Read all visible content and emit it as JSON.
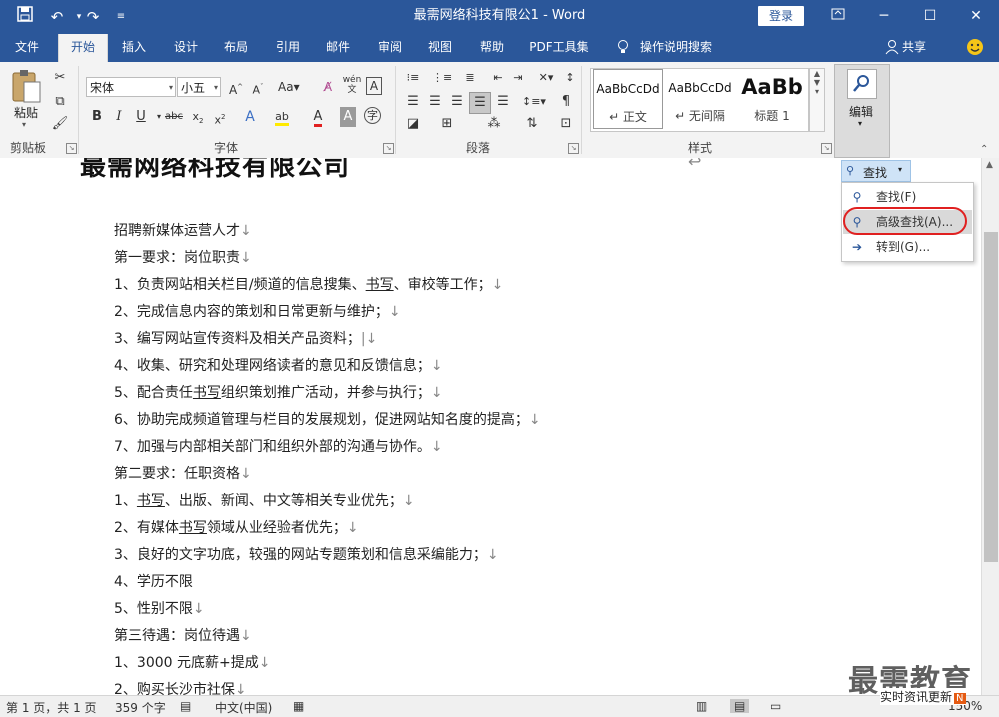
{
  "titlebar": {
    "title": "最需网络科技有限公1  -  Word",
    "login": "登录",
    "save_icon": "save-icon",
    "undo_icon": "undo-icon",
    "redo_icon": "redo-icon",
    "customize_icon": "customize-qat-icon",
    "bg": "#2b579a"
  },
  "tabs": [
    "文件",
    "开始",
    "插入",
    "设计",
    "布局",
    "引用",
    "邮件",
    "审阅",
    "视图",
    "帮助",
    "PDF工具集"
  ],
  "tell_me": "操作说明搜索",
  "share": "共享",
  "ribbon": {
    "clipboard": {
      "label": "剪贴板",
      "paste": "粘贴"
    },
    "font": {
      "label": "字体",
      "name": "宋体",
      "size": "小五",
      "bold": "B",
      "italic": "I",
      "underline": "U"
    },
    "paragraph": {
      "label": "段落"
    },
    "styles": {
      "label": "样式",
      "items": [
        {
          "sample": "AaBbCcDd",
          "name": "↵ 正文"
        },
        {
          "sample": "AaBbCcDd",
          "name": "↵ 无间隔"
        },
        {
          "sample": "AaBb",
          "name": "标题 1"
        }
      ]
    },
    "editing": {
      "label": "编辑"
    }
  },
  "find_menu": {
    "button": "查找",
    "items": [
      {
        "label": "查找(F)",
        "icon": "search-icon"
      },
      {
        "label": "高级查找(A)...",
        "icon": "search-icon"
      },
      {
        "label": "转到(G)...",
        "icon": "arrow-right-icon"
      }
    ]
  },
  "document": {
    "heading": "最需网络科技有限公司",
    "lines": [
      "招聘新媒体运营人才",
      "第一要求：岗位职责",
      "1、负责网站相关栏目/频道的信息搜集、书写、审校等工作；",
      "2、完成信息内容的策划和日常更新与维护；",
      "3、编写网站宣传资料及相关产品资料；",
      "4、收集、研究和处理网络读者的意见和反馈信息；",
      "5、配合责任书写组织策划推广活动，并参与执行；",
      "6、协助完成频道管理与栏目的发展规划，促进网站知名度的提高；",
      "7、加强与内部相关部门和组织外部的沟通与协作。",
      "第二要求：任职资格",
      "1、书写、出版、新闻、中文等相关专业优先；",
      "2、有媒体书写领域从业经验者优先；",
      "3、良好的文字功底，较强的网站专题策划和信息采编能力；",
      "4、学历不限",
      "5、性别不限",
      "第三待遇：岗位待遇",
      "1、3000 元底薪+提成",
      "2、购买长沙市社保"
    ]
  },
  "statusbar": {
    "page": "第 1 页，共 1 页",
    "words": "359 个字",
    "lang": "中文(中国)",
    "zoom": "150%"
  },
  "watermark": {
    "main": "最需教育",
    "sub": "实时资讯更新"
  }
}
